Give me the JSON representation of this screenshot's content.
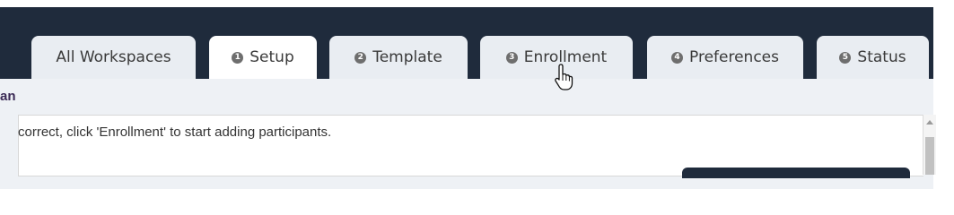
{
  "colors": {
    "top_bar": "#1f2b3c",
    "tab_bg": "#e9edf2",
    "active_tab_bg": "#ffffff",
    "heading_text": "#3b2a55"
  },
  "tabs": [
    {
      "label": "All Workspaces",
      "number": ""
    },
    {
      "label": "Setup",
      "number": "1"
    },
    {
      "label": "Template",
      "number": "2"
    },
    {
      "label": "Enrollment",
      "number": "3"
    },
    {
      "label": "Preferences",
      "number": "4"
    },
    {
      "label": "Status",
      "number": "5"
    }
  ],
  "active_tab": "Setup",
  "section": {
    "heading": "an",
    "message": "correct, click 'Enrollment' to start adding participants."
  },
  "cursor": "hand-pointer-icon"
}
